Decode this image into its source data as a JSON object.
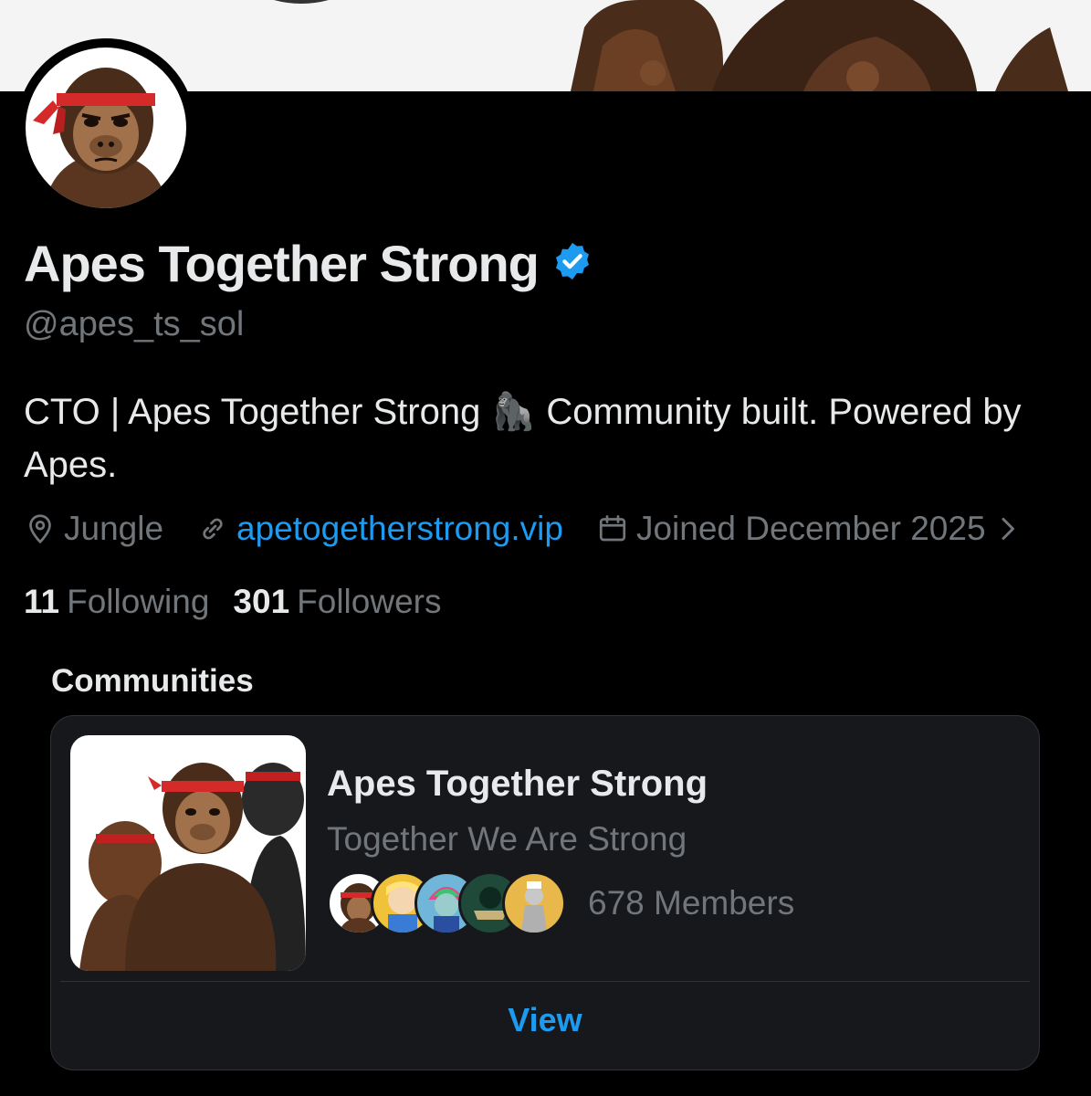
{
  "profile": {
    "name": "Apes Together Strong",
    "handle": "@apes_ts_sol",
    "verified": true,
    "bio": "CTO | Apes Together Strong 🦍 Community built. Powered by Apes.",
    "location": "Jungle",
    "website": "apetogetherstrong.vip",
    "joined": "Joined December 2025",
    "following_count": "11",
    "following_label": "Following",
    "followers_count": "301",
    "followers_label": "Followers"
  },
  "communities": {
    "section_title": "Communities",
    "card": {
      "title": "Apes Together Strong",
      "subtitle": "Together We Are Strong",
      "members": "678 Members",
      "view_label": "View"
    }
  },
  "icons": {
    "verified": "verified-badge-icon",
    "location": "location-pin-icon",
    "link": "link-icon",
    "calendar": "calendar-icon",
    "expand": "chevron-right-icon"
  },
  "colors": {
    "accent": "#1d9bf0",
    "background": "#000000",
    "card": "#16181c",
    "muted": "#71767b",
    "text": "#e7e9ea"
  }
}
